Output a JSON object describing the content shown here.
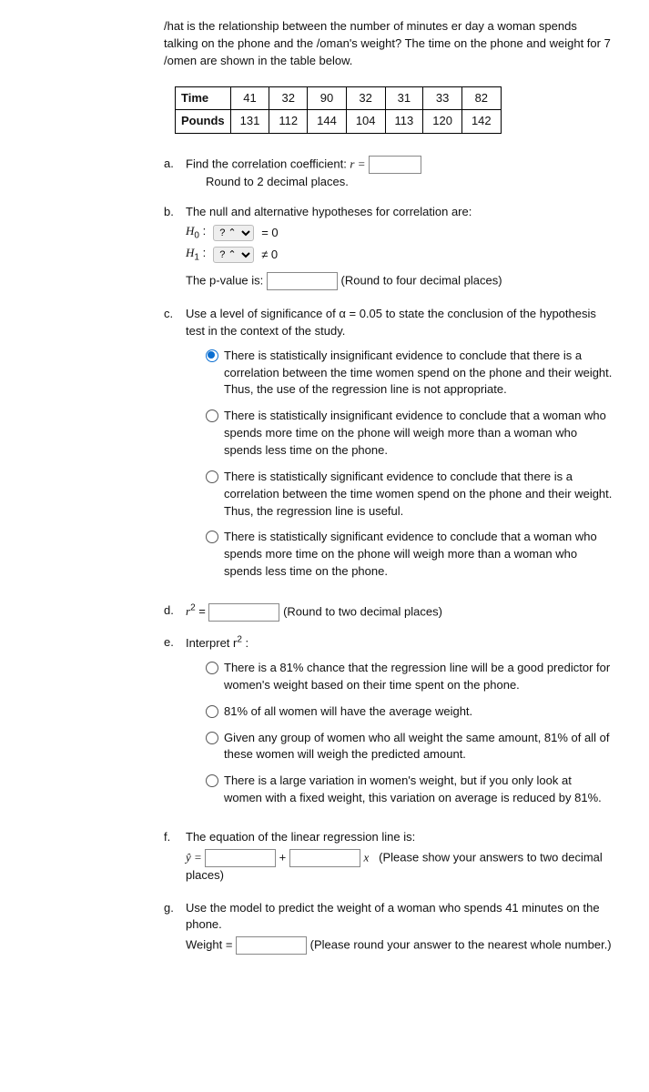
{
  "intro": "/hat is the relationship between the number of minutes er day a woman spends talking on the phone and the /oman's weight? The time on the phone and weight for 7 /omen are shown in the table below.",
  "table": {
    "row1_label": "Time",
    "row2_label": "Pounds",
    "time": [
      "41",
      "32",
      "90",
      "32",
      "31",
      "33",
      "82"
    ],
    "pounds": [
      "131",
      "112",
      "144",
      "104",
      "113",
      "120",
      "142"
    ]
  },
  "a": {
    "line1_pre": "Find the correlation coefficient:  ",
    "r_eq": "r =",
    "line2": "Round to 2 decimal places."
  },
  "b": {
    "text": "The null and alternative hypotheses for correlation are:",
    "H0": "H",
    "H0sub": "0",
    "H1": "H",
    "H1sub": "1",
    "colon": " :",
    "sel_placeholder": "?",
    "eq0": "=  0",
    "neq0": "≠  0",
    "pval_pre": "The p-value is:",
    "pval_post": "(Round to four decimal places)"
  },
  "c": {
    "text": "Use a level of significance of α = 0.05 to state the conclusion of the hypothesis test in the context of the study.",
    "opts": [
      "There is statistically insignificant evidence to conclude that there is a correlation between the time women spend on the phone and their weight. Thus, the use of the regression line is not appropriate.",
      "There is statistically insignificant evidence to conclude that a woman who spends more time on the phone will weigh more than a woman who spends less time on the phone.",
      "There is statistically significant evidence to conclude that there is a correlation between the time women spend on the phone and their weight. Thus, the regression line is useful.",
      "There is statistically significant evidence to conclude that a woman who spends more time on the phone will weigh more than a woman who spends less time on the phone."
    ]
  },
  "d": {
    "pre": "r",
    "sup": "2",
    "eq": " = ",
    "post": "(Round to two decimal places)"
  },
  "e": {
    "text": "Interpret r",
    "sup": "2",
    "colon": " :",
    "opts": [
      "There is a 81% chance that the regression line will be a good predictor for women's weight based on their time spent on the phone.",
      "81% of all women will have the average weight.",
      "Given any group of women who all weight the same amount, 81% of all of these women will weigh the predicted amount.",
      "There is a large variation in women's weight, but if you only look at women with a fixed weight, this variation on average is reduced by 81%."
    ]
  },
  "f": {
    "text": "The equation of the linear regression line is:",
    "yhat": "ŷ = ",
    "plus": " + ",
    "x": "x",
    "post": "(Please show your answers to two decimal places)"
  },
  "g": {
    "text": "Use the model to predict the weight of a woman who spends 41 minutes on the phone.",
    "weight": "Weight = ",
    "post": "(Please round your answer to the nearest whole number.)"
  },
  "markers": {
    "a": "a.",
    "b": "b.",
    "c": "c.",
    "d": "d.",
    "e": "e.",
    "f": "f.",
    "g": "g."
  }
}
